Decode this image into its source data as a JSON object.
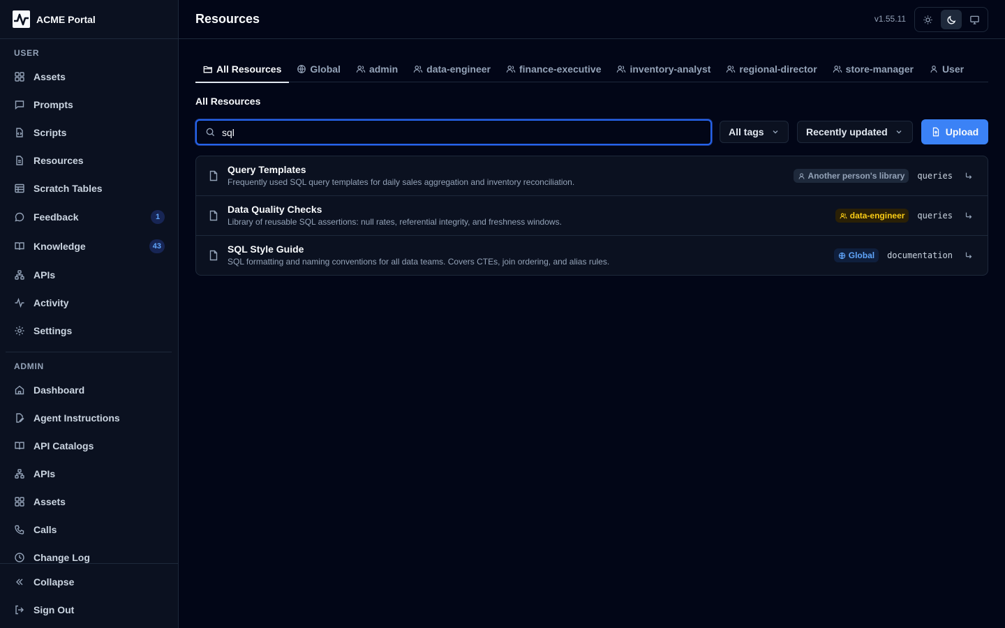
{
  "app": {
    "name": "ACME Portal",
    "version": "v1.55.11"
  },
  "header": {
    "title": "Resources"
  },
  "sidebar": {
    "user_label": "USER",
    "user_items": [
      {
        "label": "Assets",
        "icon": "grid-icon"
      },
      {
        "label": "Prompts",
        "icon": "message-square-icon"
      },
      {
        "label": "Scripts",
        "icon": "file-code-icon"
      },
      {
        "label": "Resources",
        "icon": "file-text-icon"
      },
      {
        "label": "Scratch Tables",
        "icon": "table-icon"
      },
      {
        "label": "Feedback",
        "icon": "message-circle-icon",
        "count": "1"
      },
      {
        "label": "Knowledge",
        "icon": "book-icon",
        "count": "43"
      },
      {
        "label": "APIs",
        "icon": "network-icon"
      },
      {
        "label": "Activity",
        "icon": "activity-icon"
      },
      {
        "label": "Settings",
        "icon": "gear-icon"
      }
    ],
    "admin_label": "ADMIN",
    "admin_items": [
      {
        "label": "Dashboard",
        "icon": "home-icon"
      },
      {
        "label": "Agent Instructions",
        "icon": "file-pen-icon"
      },
      {
        "label": "API Catalogs",
        "icon": "book-icon"
      },
      {
        "label": "APIs",
        "icon": "network-icon"
      },
      {
        "label": "Assets",
        "icon": "grid-icon"
      },
      {
        "label": "Calls",
        "icon": "phone-icon"
      },
      {
        "label": "Change Log",
        "icon": "clock-icon"
      }
    ],
    "collapse_label": "Collapse",
    "signout_label": "Sign Out"
  },
  "tabs": [
    {
      "label": "All Resources",
      "icon": "folder-icon",
      "active": true
    },
    {
      "label": "Global",
      "icon": "globe-icon"
    },
    {
      "label": "admin",
      "icon": "users-icon"
    },
    {
      "label": "data-engineer",
      "icon": "users-icon"
    },
    {
      "label": "finance-executive",
      "icon": "users-icon"
    },
    {
      "label": "inventory-analyst",
      "icon": "users-icon"
    },
    {
      "label": "regional-director",
      "icon": "users-icon"
    },
    {
      "label": "store-manager",
      "icon": "users-icon"
    },
    {
      "label": "User",
      "icon": "user-icon"
    }
  ],
  "section_title": "All Resources",
  "search": {
    "value": "sql",
    "placeholder": ""
  },
  "filters": {
    "tags": "All tags",
    "sort": "Recently updated"
  },
  "upload_label": "Upload",
  "resources": [
    {
      "title": "Query Templates",
      "description": "Frequently used SQL query templates for daily sales aggregation and inventory reconciliation.",
      "scope": "Another person's library",
      "scope_type": "person",
      "tag": "queries"
    },
    {
      "title": "Data Quality Checks",
      "description": "Library of reusable SQL assertions: null rates, referential integrity, and freshness windows.",
      "scope": "data-engineer",
      "scope_type": "role",
      "tag": "queries"
    },
    {
      "title": "SQL Style Guide",
      "description": "SQL formatting and naming conventions for all data teams. Covers CTEs, join ordering, and alias rules.",
      "scope": "Global",
      "scope_type": "global",
      "tag": "documentation"
    }
  ],
  "colors": {
    "accent": "#3b82f6",
    "background": "#020617",
    "sidebar": "#0b1120",
    "role_badge": "#facc15",
    "global_badge": "#60a5fa"
  }
}
